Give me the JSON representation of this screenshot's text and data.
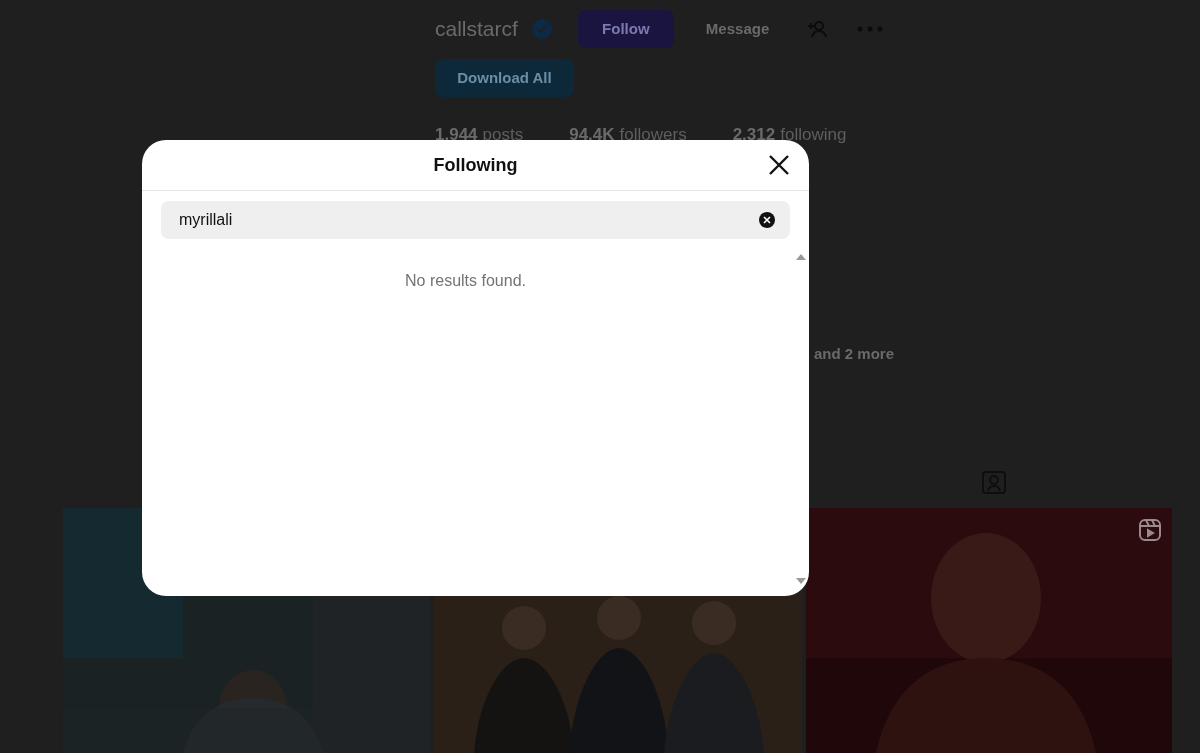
{
  "profile": {
    "username": "callstarcf",
    "verified": true,
    "follow_button": "Follow",
    "message_button": "Message",
    "download_button": "Download All",
    "stats": [
      {
        "value": "1,944",
        "label": "posts"
      },
      {
        "value": "94.4K",
        "label": "followers"
      },
      {
        "value": "2,312",
        "label": "following"
      }
    ],
    "followed_by_more": "and 2 more"
  },
  "grid": [
    {
      "reel": false
    },
    {
      "reel": false
    },
    {
      "reel": true
    }
  ],
  "modal": {
    "title": "Following",
    "search": {
      "value": "myrillali"
    },
    "empty_message": "No results found."
  }
}
